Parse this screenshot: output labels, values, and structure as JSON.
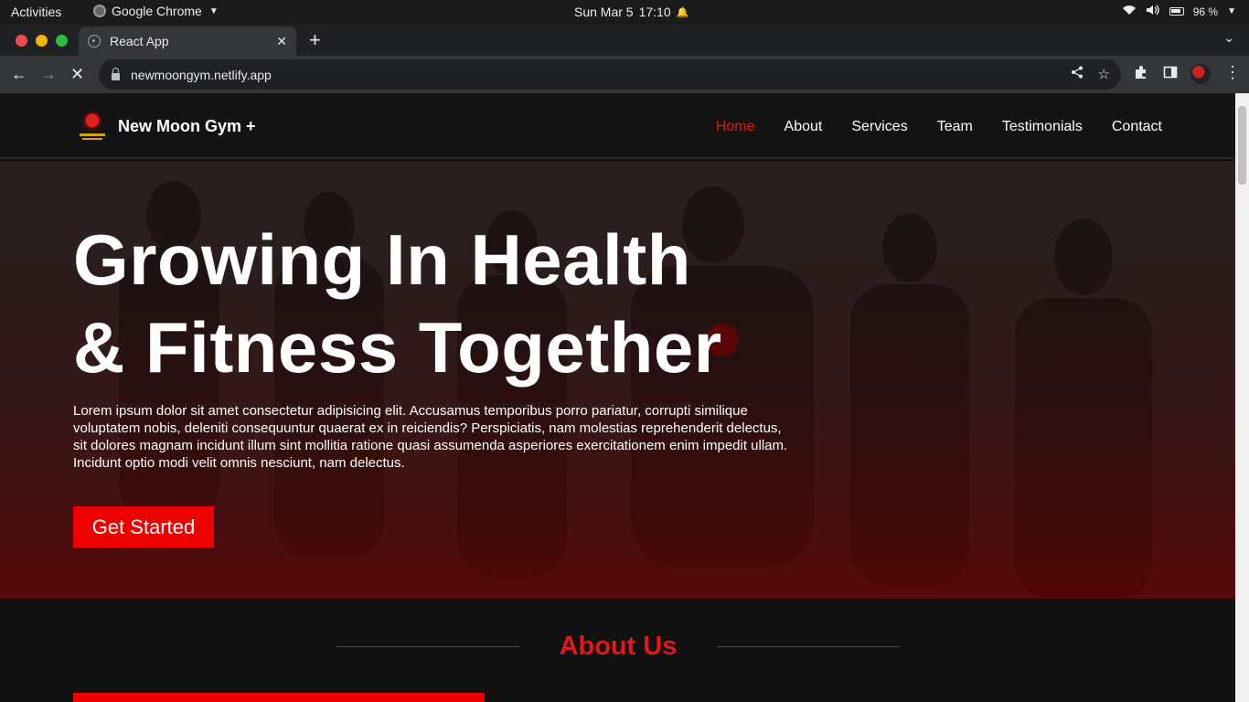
{
  "system_bar": {
    "activities": "Activities",
    "app_name": "Google Chrome",
    "date": "Sun Mar 5",
    "time": "17:10",
    "battery": "96 %"
  },
  "browser": {
    "tab_title": "React App",
    "url": "newmoongym.netlify.app"
  },
  "site": {
    "brand": "New Moon Gym +",
    "nav": [
      "Home",
      "About",
      "Services",
      "Team",
      "Testimonials",
      "Contact"
    ],
    "active_nav": "Home",
    "hero": {
      "title_line1": "Growing In Health",
      "title_line2": "& Fitness Together",
      "text": "Lorem ipsum dolor sit amet consectetur adipisicing elit. Accusamus temporibus porro pariatur, corrupti similique voluptatem nobis, deleniti consequuntur quaerat ex in reiciendis? Perspiciatis, nam molestias reprehenderit delectus, sit dolores magnam incidunt illum sint mollitia ratione quasi assumenda asperiores exercitationem enim impedit ullam. Incidunt optio modi velit omnis nesciunt, nam delectus.",
      "cta": "Get Started"
    },
    "about": {
      "title": "About Us"
    }
  },
  "colors": {
    "accent": "#ef0000",
    "nav_active": "#e01818",
    "navbar_bg": "#141414",
    "page_bg": "#111111"
  }
}
